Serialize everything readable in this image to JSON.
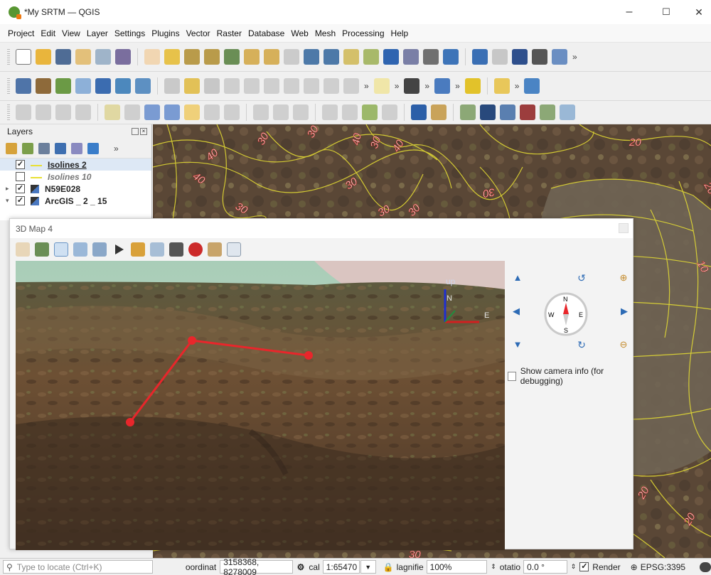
{
  "window": {
    "title": "*My SRTM — QGIS",
    "minimize": "–",
    "maximize": "☐",
    "close": "✕"
  },
  "menu": [
    "Project",
    "Edit",
    "View",
    "Layer",
    "Settings",
    "Plugins",
    "Vector",
    "Raster",
    "Database",
    "Web",
    "Mesh",
    "Processing",
    "Help"
  ],
  "toolbar_more": "»",
  "layers_panel": {
    "title": "Layers",
    "more": "»",
    "items": [
      {
        "name": "Isolines 2",
        "checked": true,
        "bold": true,
        "underline": true,
        "italic": false,
        "expander": ""
      },
      {
        "name": "Isolines 10",
        "checked": false,
        "bold": true,
        "underline": false,
        "italic": true,
        "expander": ""
      },
      {
        "name": "N59E028",
        "checked": true,
        "bold": true,
        "underline": false,
        "italic": false,
        "expander": "▸"
      },
      {
        "name": "ArcGIS _ 2 _ 15",
        "checked": true,
        "bold": true,
        "underline": false,
        "italic": false,
        "expander": "▾"
      }
    ]
  },
  "map": {
    "contour_labels": [
      "30",
      "30",
      "40",
      "30",
      "40",
      "40",
      "40",
      "30",
      "30",
      "30",
      "20",
      "20",
      "20",
      "30",
      "10",
      "30",
      "30",
      "20"
    ]
  },
  "map3d": {
    "title": "3D Map 4",
    "axis_up": "up",
    "axis_n": "N",
    "axis_e": "E",
    "compass": {
      "n": "N",
      "s": "S",
      "e": "E",
      "w": "W"
    },
    "debug_label": "Show camera info (for debugging)",
    "debug_checked": false
  },
  "statusbar": {
    "search_placeholder": "Type to locate (Ctrl+K)",
    "coord_label": "oordinat",
    "coord_value": "3158368, 8278009",
    "scale_label": "cal",
    "scale_value": "1:65470",
    "magnifier_label": "lagnifiе",
    "magnifier_value": "100%",
    "rotation_label": "otatio",
    "rotation_value": "0.0 °",
    "render_label": "Render",
    "render_checked": true,
    "crs": "EPSG:3395"
  },
  "colors": {
    "accent": "#2d6bb5",
    "contour": "#e8e033",
    "route": "#e8262b",
    "qgis_green": "#589632"
  }
}
